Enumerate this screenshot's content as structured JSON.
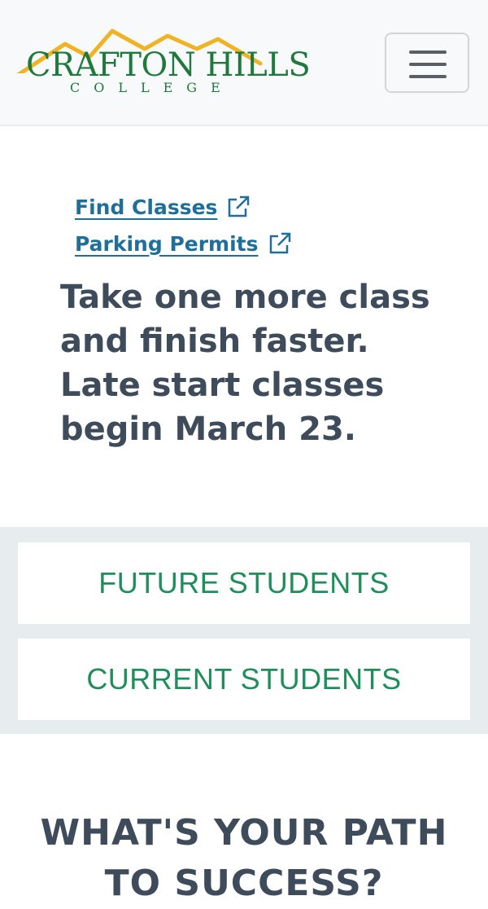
{
  "header": {
    "logo_main": "CRAFTON HILLS",
    "logo_sub": "COLLEGE",
    "menu_icon": "hamburger-menu-icon",
    "colors": {
      "logo_green": "#1e7a3c",
      "logo_gold": "#f0b323"
    }
  },
  "quick_links": [
    {
      "label": "Find Classes",
      "icon": "external-link-icon"
    },
    {
      "label": "Parking Permits",
      "icon": "external-link-icon"
    }
  ],
  "promo": {
    "text": "Take one more class and finish faster. Late start classes begin March 23."
  },
  "audience": {
    "future": "FUTURE STUDENTS",
    "current": "CURRENT STUDENTS"
  },
  "path": {
    "heading_line1": "WHAT'S YOUR PATH",
    "heading_line2": "TO SUCCESS?"
  },
  "colors": {
    "link": "#1f6f9a",
    "heading": "#3e4b5b",
    "green": "#1e8f5a",
    "section_bg": "#e7ecef"
  }
}
